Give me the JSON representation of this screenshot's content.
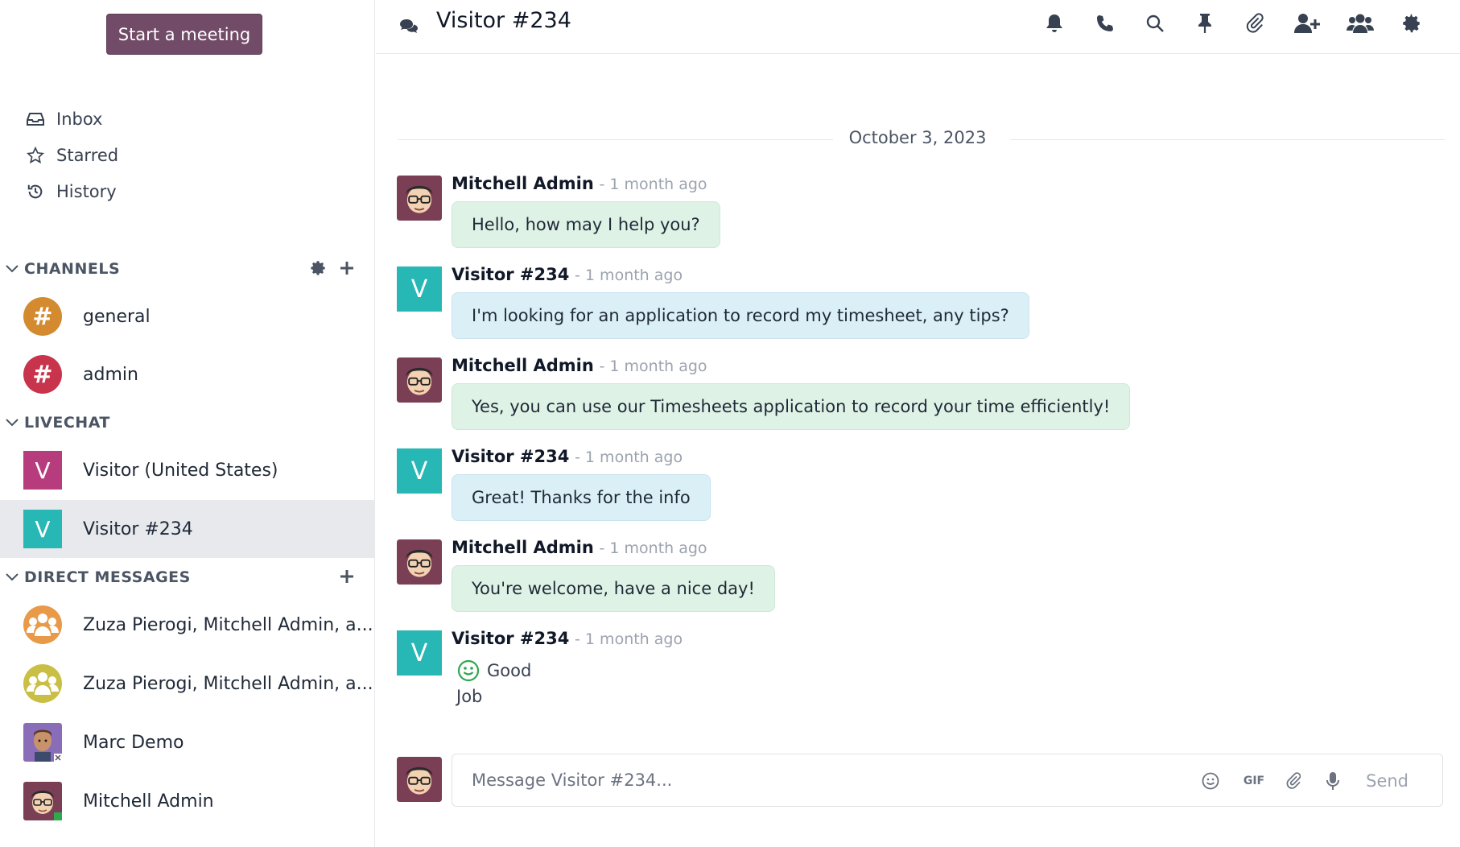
{
  "sidebar": {
    "start_meeting_label": "Start a meeting",
    "nav": [
      {
        "label": "Inbox",
        "icon": "inbox-icon"
      },
      {
        "label": "Starred",
        "icon": "star-icon"
      },
      {
        "label": "History",
        "icon": "history-icon"
      }
    ],
    "channels": {
      "header": "CHANNELS",
      "items": [
        {
          "name": "general",
          "color": "#d48a2f"
        },
        {
          "name": "admin",
          "color": "#c8344c"
        }
      ]
    },
    "livechat": {
      "header": "LIVECHAT",
      "items": [
        {
          "name": "Visitor (United States)",
          "initial": "V",
          "color": "#b73c7e"
        },
        {
          "name": "Visitor #234",
          "initial": "V",
          "color": "#27b7b5",
          "active": true
        }
      ]
    },
    "direct_messages": {
      "header": "DIRECT MESSAGES",
      "items": [
        {
          "name": "Zuza Pierogi, Mitchell Admin, a...",
          "icon": "group-icon",
          "color": "#e89a49"
        },
        {
          "name": "Zuza Pierogi, Mitchell Admin, a...",
          "icon": "group-icon",
          "color": "#c9bf45"
        },
        {
          "name": "Marc Demo",
          "icon": "avatar"
        },
        {
          "name": "Mitchell Admin",
          "icon": "avatar"
        }
      ]
    }
  },
  "thread": {
    "title": "Visitor #234",
    "date_separator": "October 3, 2023",
    "messages": [
      {
        "author": "Mitchell Admin",
        "meta": "- 1 month ago",
        "text": "Hello, how may I help you?",
        "kind": "admin"
      },
      {
        "author": "Visitor #234",
        "meta": "- 1 month ago",
        "text": "I'm looking for an application to record my timesheet, any tips?",
        "kind": "visitor"
      },
      {
        "author": "Mitchell Admin",
        "meta": "- 1 month ago",
        "text": "Yes, you can use our Timesheets application to record your time efficiently!",
        "kind": "admin"
      },
      {
        "author": "Visitor #234",
        "meta": "- 1 month ago",
        "text": "Great! Thanks for the info",
        "kind": "visitor"
      },
      {
        "author": "Mitchell Admin",
        "meta": "- 1 month ago",
        "text": "You're welcome, have a nice day!",
        "kind": "admin"
      },
      {
        "author": "Visitor #234",
        "meta": "- 1 month ago",
        "rating": "Good",
        "rating_comment": "Job",
        "kind": "rating"
      }
    ]
  },
  "composer": {
    "placeholder": "Message Visitor #234...",
    "gif_label": "GIF",
    "send_label": "Send"
  },
  "colors": {
    "brand": "#714b67",
    "visitor_teal": "#27b7b5",
    "admin_bubble": "#dff2e6",
    "visitor_bubble": "#dbeff6"
  }
}
